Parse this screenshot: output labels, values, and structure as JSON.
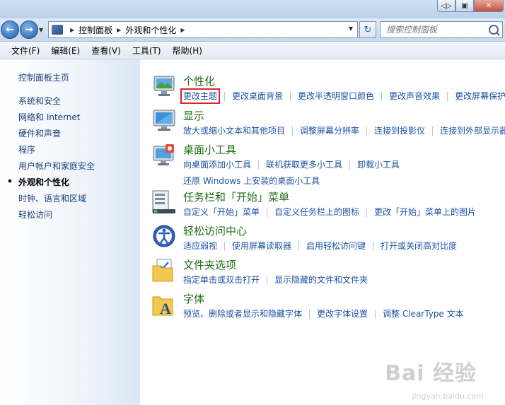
{
  "window": {
    "buttons": [
      "◁▷",
      "▣",
      "✕"
    ]
  },
  "address_bar": {
    "crumbs": [
      "控制面板",
      "外观和个性化"
    ]
  },
  "search": {
    "placeholder": "搜索控制面板"
  },
  "menu": [
    "文件(F)",
    "编辑(E)",
    "查看(V)",
    "工具(T)",
    "帮助(H)"
  ],
  "sidebar": {
    "home": "控制面板主页",
    "items": [
      {
        "label": "系统和安全",
        "active": false
      },
      {
        "label": "网络和 Internet",
        "active": false
      },
      {
        "label": "硬件和声音",
        "active": false
      },
      {
        "label": "程序",
        "active": false
      },
      {
        "label": "用户帐户和家庭安全",
        "active": false
      },
      {
        "label": "外观和个性化",
        "active": true
      },
      {
        "label": "时钟、语言和区域",
        "active": false
      },
      {
        "label": "轻松访问",
        "active": false
      }
    ]
  },
  "categories": [
    {
      "title": "个性化",
      "icon": "personalization-icon",
      "links": [
        [
          "更改主题",
          "更改桌面背景",
          "更改半透明窗口颜色",
          "更改声音效果",
          "更改屏幕保护"
        ]
      ]
    },
    {
      "title": "显示",
      "icon": "display-icon",
      "links": [
        [
          "放大或缩小文本和其他项目",
          "调整屏幕分辨率",
          "连接到投影仪",
          "连接到外部显示器"
        ]
      ]
    },
    {
      "title": "桌面小工具",
      "icon": "gadgets-icon",
      "links": [
        [
          "向桌面添加小工具",
          "联机获取更多小工具",
          "卸载小工具"
        ],
        [
          "还原 Windows 上安装的桌面小工具"
        ]
      ]
    },
    {
      "title": "任务栏和「开始」菜单",
      "icon": "taskbar-icon",
      "links": [
        [
          "自定义「开始」菜单",
          "自定义任务栏上的图标",
          "更改「开始」菜单上的图片"
        ]
      ]
    },
    {
      "title": "轻松访问中心",
      "icon": "ease-of-access-icon",
      "links": [
        [
          "适应弱视",
          "使用屏幕读取器",
          "启用轻松访问键",
          "打开或关闭高对比度"
        ]
      ]
    },
    {
      "title": "文件夹选项",
      "icon": "folder-options-icon",
      "links": [
        [
          "指定单击或双击打开",
          "显示隐藏的文件和文件夹"
        ]
      ]
    },
    {
      "title": "字体",
      "icon": "fonts-icon",
      "links": [
        [
          "预览、删除或者显示和隐藏字体",
          "更改字体设置",
          "调整 ClearType 文本"
        ]
      ]
    }
  ],
  "highlight_color": "#d8262b",
  "accent_link": "#1a52a5",
  "category_title_color": "#1e6f15",
  "watermark": {
    "main": "Bai 经验",
    "sub": "jingyan.baidu.com"
  }
}
